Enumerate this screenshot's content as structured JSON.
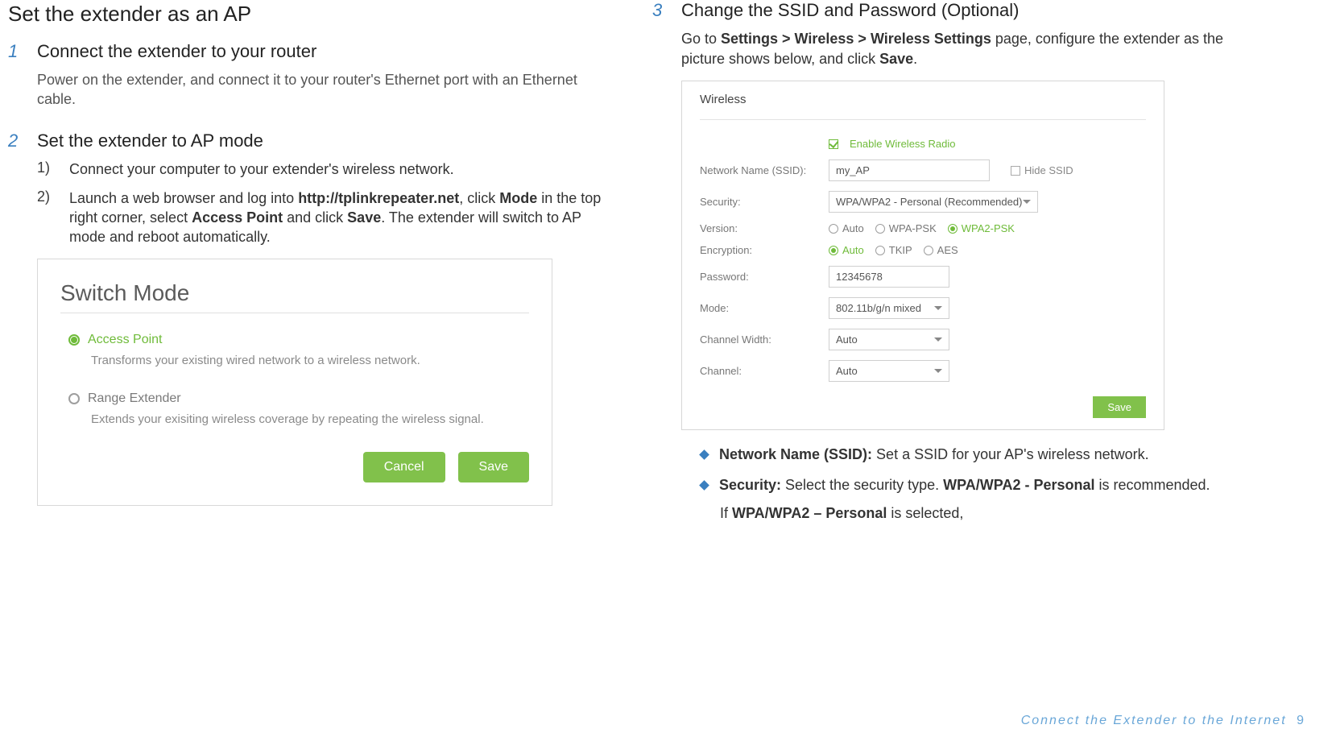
{
  "left": {
    "section_title": "Set the extender as an AP",
    "step1": {
      "num": "1",
      "title": "Connect the extender to your router",
      "desc": "Power on the extender, and connect it to your router's Ethernet port with an Ethernet cable."
    },
    "step2": {
      "num": "2",
      "title": "Set the extender to AP mode",
      "sub1": {
        "num": "1)",
        "text": "Connect your computer to your extender's wireless network."
      },
      "sub2": {
        "num": "2)",
        "pre": "Launch a web browser and log into ",
        "url": "http://tplinkrepeater.net",
        "mid1": ", click ",
        "mode": "Mode",
        "mid2": " in the top right corner, select ",
        "ap": "Access Point",
        "mid3": " and click ",
        "save": "Save",
        "tail": ". The extender will switch to AP mode and reboot automatically."
      }
    },
    "switch_panel": {
      "title": "Switch Mode",
      "opt1": {
        "label": "Access Point",
        "desc": "Transforms your existing wired network to a wireless network."
      },
      "opt2": {
        "label": "Range Extender",
        "desc": "Extends your exisiting wireless coverage by repeating the wireless signal."
      },
      "cancel": "Cancel",
      "save": "Save"
    }
  },
  "right": {
    "step3": {
      "num": "3",
      "title": "Change the SSID and Password (Optional)",
      "pre": "Go to ",
      "path": "Settings > Wireless > Wireless Settings",
      "mid": " page, configure the extender as the picture shows below, and click ",
      "save": "Save",
      "tail": "."
    },
    "wireless": {
      "head": "Wireless",
      "enable": "Enable Wireless Radio",
      "ssid_label": "Network Name (SSID):",
      "ssid_value": "my_AP",
      "hide_ssid": "Hide SSID",
      "security_label": "Security:",
      "security_value": "WPA/WPA2 - Personal (Recommended)",
      "version_label": "Version:",
      "version_opts": {
        "auto": "Auto",
        "wpa": "WPA-PSK",
        "wpa2": "WPA2-PSK"
      },
      "encryption_label": "Encryption:",
      "encryption_opts": {
        "auto": "Auto",
        "tkip": "TKIP",
        "aes": "AES"
      },
      "password_label": "Password:",
      "password_value": "12345678",
      "mode_label": "Mode:",
      "mode_value": "802.11b/g/n mixed",
      "chwidth_label": "Channel Width:",
      "chwidth_value": "Auto",
      "channel_label": "Channel:",
      "channel_value": "Auto",
      "save": "Save"
    },
    "notes": {
      "n1": {
        "label": "Network Name (SSID):",
        "text": " Set a SSID for your AP's wireless network."
      },
      "n2": {
        "label": "Security:",
        "mid": " Select the security type. ",
        "strong": "WPA/WPA2 - Personal",
        "tail": " is recommended."
      },
      "n3": {
        "pre": "If ",
        "strong": "WPA/WPA2 – Personal",
        "tail": " is selected,"
      }
    }
  },
  "footer": {
    "text": "Connect the Extender to the Internet",
    "page": "9"
  }
}
